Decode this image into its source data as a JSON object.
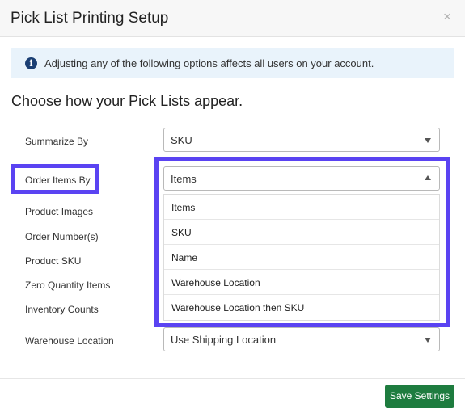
{
  "modal": {
    "title": "Pick List Printing Setup",
    "close_label": "×"
  },
  "info": {
    "icon": "info-circle-icon",
    "icon_glyph": "i",
    "text": "Adjusting any of the following options affects all users on your account."
  },
  "heading": "Choose how your Pick Lists appear.",
  "fields": {
    "summarize_by": {
      "label": "Summarize By",
      "value": "SKU"
    },
    "order_items_by": {
      "label": "Order Items By",
      "value": "Items"
    },
    "product_images": {
      "label": "Product Images"
    },
    "order_numbers": {
      "label": "Order Number(s)"
    },
    "product_sku": {
      "label": "Product SKU"
    },
    "zero_quantity_items": {
      "label": "Zero Quantity Items"
    },
    "inventory_counts": {
      "label": "Inventory Counts"
    },
    "warehouse_location": {
      "label": "Warehouse Location",
      "value": "Use Shipping Location"
    }
  },
  "order_items_dropdown": {
    "options": [
      "Items",
      "SKU",
      "Name",
      "Warehouse Location",
      "Warehouse Location then SKU"
    ]
  },
  "footer": {
    "save_label": "Save Settings"
  },
  "colors": {
    "highlight": "#5a43f2",
    "save_button": "#1e7c3f",
    "info_background": "#e9f3fb",
    "info_icon": "#1b3f73"
  }
}
